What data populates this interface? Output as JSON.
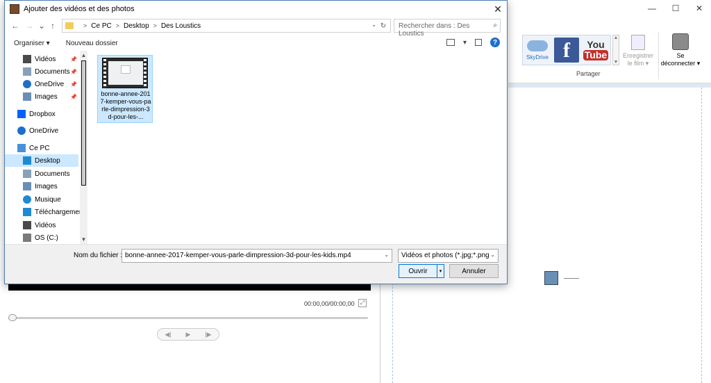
{
  "dialog": {
    "title": "Ajouter des vidéos et des photos",
    "close_glyph": "✕"
  },
  "nav": {
    "back": "←",
    "forward": "→",
    "recent": "⌄",
    "up": "↑",
    "breadcrumb": [
      "Ce PC",
      "Desktop",
      "Des Loustics"
    ],
    "crumb_sep": ">",
    "dropdown": "⌄",
    "refresh": "↻",
    "search_placeholder": "Rechercher dans : Des Loustics",
    "search_glyph": "⌕"
  },
  "toolbar": {
    "organize": "Organiser ▾",
    "new_folder": "Nouveau dossier",
    "view_dd": "▾",
    "help": "?"
  },
  "sidebar": {
    "items": [
      {
        "label": "Vidéos",
        "pinned": true,
        "icon": "video-folder-icon",
        "color": "#4a4a4a"
      },
      {
        "label": "Documents",
        "pinned": true,
        "icon": "documents-folder-icon",
        "color": "#8aa0b8"
      },
      {
        "label": "OneDrive",
        "pinned": true,
        "icon": "onedrive-icon",
        "color": "#1e6fc9"
      },
      {
        "label": "Images",
        "pinned": true,
        "icon": "images-folder-icon",
        "color": "#6a8fb7"
      },
      {
        "label": "Dropbox",
        "pinned": false,
        "icon": "dropbox-icon",
        "color": "#0061fe"
      },
      {
        "label": "OneDrive",
        "pinned": false,
        "icon": "onedrive-icon",
        "color": "#1e6fc9"
      },
      {
        "label": "Ce PC",
        "pinned": false,
        "icon": "computer-icon",
        "color": "#4a90d9"
      },
      {
        "label": "Desktop",
        "pinned": false,
        "icon": "desktop-folder-icon",
        "color": "#1e8ad6",
        "selected": true
      },
      {
        "label": "Documents",
        "pinned": false,
        "icon": "documents-folder-icon",
        "color": "#8aa0b8"
      },
      {
        "label": "Images",
        "pinned": false,
        "icon": "images-folder-icon",
        "color": "#6a8fb7"
      },
      {
        "label": "Musique",
        "pinned": false,
        "icon": "music-folder-icon",
        "color": "#1e8ad6"
      },
      {
        "label": "Téléchargement",
        "pinned": false,
        "icon": "downloads-folder-icon",
        "color": "#1e8ad6"
      },
      {
        "label": "Vidéos",
        "pinned": false,
        "icon": "video-folder-icon",
        "color": "#4a4a4a"
      },
      {
        "label": "OS (C:)",
        "pinned": false,
        "icon": "drive-icon",
        "color": "#7a7a7a"
      }
    ],
    "pin_glyph": "📌",
    "scroll_up": "▲",
    "scroll_down": "▼"
  },
  "files": [
    {
      "name": "bonne-annee-2017-kemper-vous-parle-dimpression-3d-pour-les-...",
      "selected": true
    }
  ],
  "bottom": {
    "filename_label": "Nom du fichier :",
    "filename_value": "bonne-annee-2017-kemper-vous-parle-dimpression-3d-pour-les-kids.mp4",
    "filter_value": "Vidéos et photos (*.jpg;*.png;*.",
    "open_label": "Ouvrir",
    "cancel_label": "Annuler",
    "dropdown": "⌄",
    "split_dd": "▾"
  },
  "app": {
    "window_buttons": [
      "—",
      "☐",
      "✕"
    ],
    "ribbon": {
      "skydrive": "SkyDrive",
      "youtube_you": "You",
      "youtube_tube": "Tube",
      "facebook": "f",
      "share_group": "Partager",
      "save_movie": "Enregistrer le film ▾",
      "sign_out": "Se déconnecter ▾",
      "scroll_up": "▲",
      "scroll_down": "▼"
    },
    "player": {
      "time": "00:00,00/00:00,00",
      "expand": "⤢",
      "prev": "◀|",
      "play": "▶",
      "next": "|▶"
    }
  }
}
